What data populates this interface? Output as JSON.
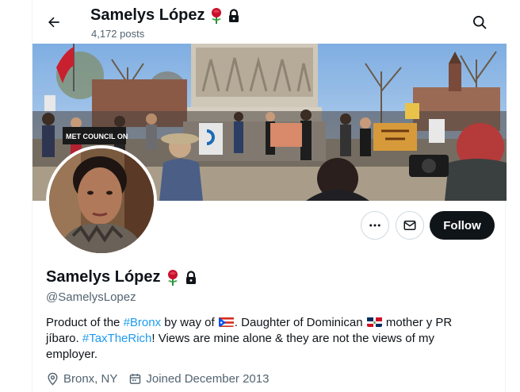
{
  "header": {
    "name": "Samelys López",
    "posts": "4,172 posts"
  },
  "actions": {
    "follow_label": "Follow"
  },
  "profile": {
    "display_name": "Samelys López",
    "handle": "@SamelysLopez",
    "bio": {
      "t1": "Product of the ",
      "tag1": "#Bronx",
      "t2": " by way of ",
      "t3": ". Daughter of Dominican ",
      "t4": " mother y PR jíbaro. ",
      "tag2": "#TaxTheRich",
      "t5": "! Views are mine alone & they are not the views of my employer."
    },
    "location": "Bronx, NY",
    "joined": "Joined December 2013"
  },
  "banner": {
    "sign_text": "MET COUNCIL ON"
  },
  "icons": {
    "back": "back-arrow-icon",
    "search": "search-icon",
    "more": "more-icon",
    "message": "message-icon",
    "rose": "rose-emoji-icon",
    "lock": "lock-icon",
    "location": "location-pin-icon",
    "calendar": "calendar-icon"
  },
  "colors": {
    "link": "#1d9bf0",
    "secondary_text": "#536471",
    "follow_bg": "#0f1419"
  }
}
